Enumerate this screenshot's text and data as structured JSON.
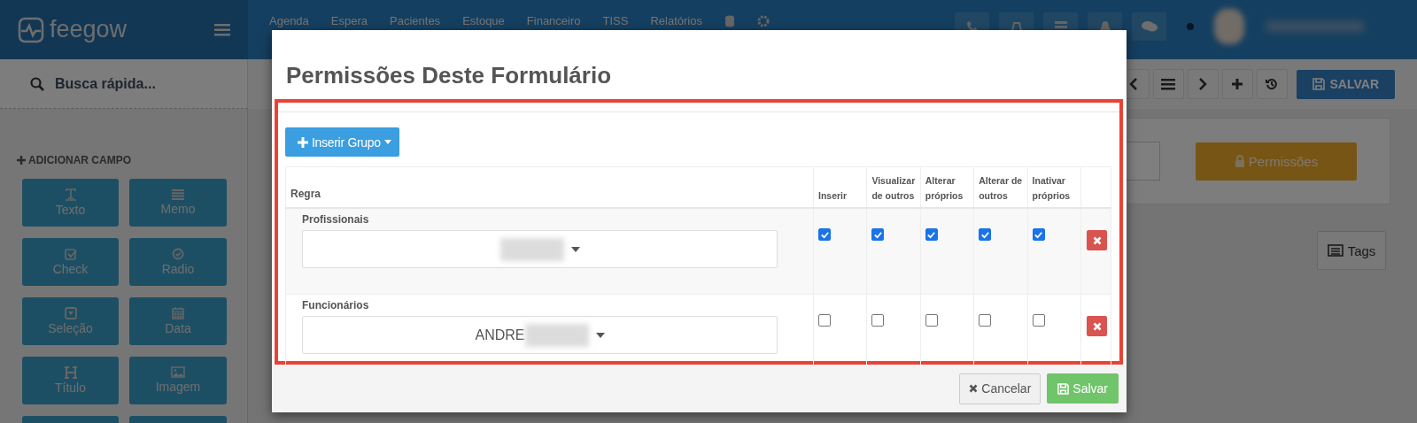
{
  "top_nav": {
    "logo": "feegow",
    "menu": [
      "Agenda",
      "Espera",
      "Pacientes",
      "Estoque",
      "Financeiro",
      "TISS",
      "Relatórios"
    ]
  },
  "search": {
    "placeholder": "Busca rápida..."
  },
  "toolbar": {
    "save": "SALVAR"
  },
  "sidebar": {
    "heading": "ADICIONAR CAMPO",
    "fields": [
      {
        "label": "Texto",
        "kind": "text"
      },
      {
        "label": "Memo",
        "kind": "memo"
      },
      {
        "label": "Check",
        "kind": "check"
      },
      {
        "label": "Radio",
        "kind": "radio"
      },
      {
        "label": "Seleção",
        "kind": "select"
      },
      {
        "label": "Data",
        "kind": "date"
      },
      {
        "label": "Título",
        "kind": "title"
      },
      {
        "label": "Imagem",
        "kind": "image"
      }
    ]
  },
  "panel": {
    "permissions": "Permissões",
    "tags": "Tags"
  },
  "modal": {
    "title": "Permissões Deste Formulário",
    "add_group": "Inserir Grupo",
    "columns": [
      "Regra",
      "Inserir",
      "Visualizar de outros",
      "Alterar próprios",
      "Alterar de outros",
      "Inativar próprios"
    ],
    "rows": [
      {
        "group": "Profissionais",
        "permissions": [
          {
            "checked": true
          },
          {
            "checked": true
          },
          {
            "checked": true
          },
          {
            "checked": true
          },
          {
            "checked": true
          }
        ]
      },
      {
        "group": "Funcionários",
        "value": "ANDRE",
        "permissions": [
          {
            "checked": false
          },
          {
            "checked": false
          },
          {
            "checked": false
          },
          {
            "checked": false
          },
          {
            "checked": false
          }
        ]
      }
    ],
    "cancel": "Cancelar",
    "save": "Salvar"
  }
}
